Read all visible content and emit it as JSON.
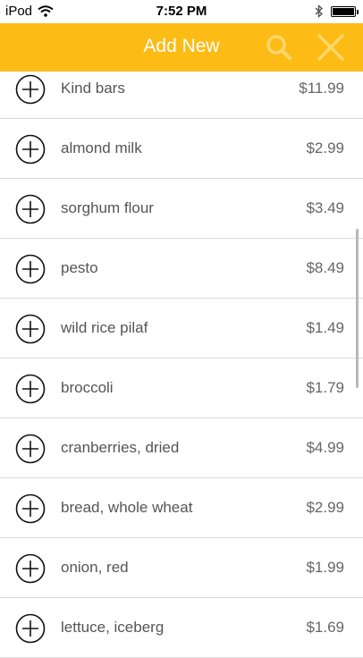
{
  "status_bar": {
    "carrier": "iPod",
    "time": "7:52 PM"
  },
  "header": {
    "title": "Add New",
    "accent_color": "#fdbb16"
  },
  "items": [
    {
      "name": "Kind bars",
      "price": "$11.99"
    },
    {
      "name": "almond milk",
      "price": "$2.99"
    },
    {
      "name": "sorghum flour",
      "price": "$3.49"
    },
    {
      "name": "pesto",
      "price": "$8.49"
    },
    {
      "name": "wild rice pilaf",
      "price": "$1.49"
    },
    {
      "name": "broccoli",
      "price": "$1.79"
    },
    {
      "name": "cranberries, dried",
      "price": "$4.99"
    },
    {
      "name": "bread, whole wheat",
      "price": "$2.99"
    },
    {
      "name": "onion, red",
      "price": "$1.99"
    },
    {
      "name": "lettuce, iceberg",
      "price": "$1.69"
    }
  ]
}
